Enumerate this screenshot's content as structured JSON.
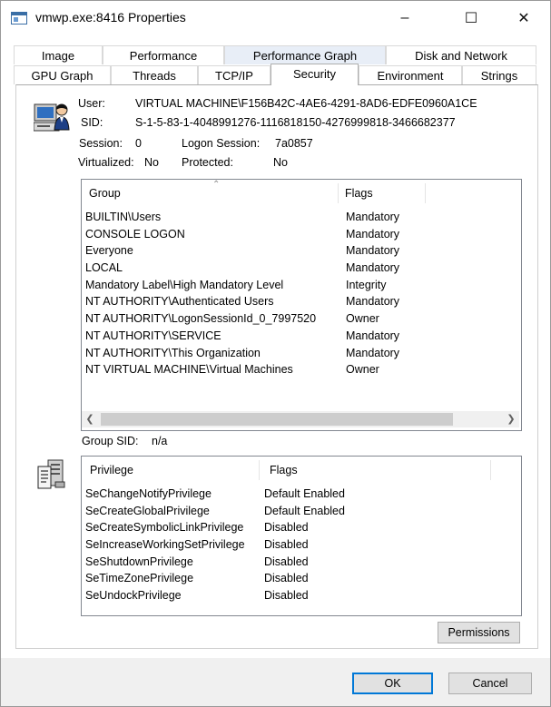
{
  "window": {
    "title": "vmwp.exe:8416 Properties",
    "controls": {
      "minimize": "–",
      "maximize": "☐",
      "close": "✕"
    }
  },
  "tabs": {
    "row1": [
      "Image",
      "Performance",
      "Performance Graph",
      "Disk and Network"
    ],
    "row2": [
      "GPU Graph",
      "Threads",
      "TCP/IP",
      "Security",
      "Environment",
      "Strings"
    ],
    "selected": "Security"
  },
  "security": {
    "user_label": "User:",
    "user_value": "VIRTUAL MACHINE\\F156B42C-4AE6-4291-8AD6-EDFE0960A1CE",
    "sid_label": "SID:",
    "sid_value": "S-1-5-83-1-4048991276-1116818150-4276999818-3466682377",
    "session_label": "Session:",
    "session_value": "0",
    "logon_label": "Logon Session:",
    "logon_value": "7a0857",
    "virtualized_label": "Virtualized:",
    "virtualized_value": "No",
    "protected_label": "Protected:",
    "protected_value": "No"
  },
  "groups": {
    "col_group": "Group",
    "col_flags": "Flags",
    "rows": [
      {
        "group": "BUILTIN\\Users",
        "flags": "Mandatory"
      },
      {
        "group": "CONSOLE LOGON",
        "flags": "Mandatory"
      },
      {
        "group": "Everyone",
        "flags": "Mandatory"
      },
      {
        "group": "LOCAL",
        "flags": "Mandatory"
      },
      {
        "group": "Mandatory Label\\High Mandatory Level",
        "flags": "Integrity"
      },
      {
        "group": "NT AUTHORITY\\Authenticated Users",
        "flags": "Mandatory"
      },
      {
        "group": "NT AUTHORITY\\LogonSessionId_0_7997520",
        "flags": "Owner"
      },
      {
        "group": "NT AUTHORITY\\SERVICE",
        "flags": "Mandatory"
      },
      {
        "group": "NT AUTHORITY\\This Organization",
        "flags": "Mandatory"
      },
      {
        "group": "NT VIRTUAL MACHINE\\Virtual Machines",
        "flags": "Owner"
      }
    ],
    "group_sid_label": "Group SID:",
    "group_sid_value": "n/a"
  },
  "privileges": {
    "col_privilege": "Privilege",
    "col_flags": "Flags",
    "rows": [
      {
        "privilege": "SeChangeNotifyPrivilege",
        "flags": "Default Enabled"
      },
      {
        "privilege": "SeCreateGlobalPrivilege",
        "flags": "Default Enabled"
      },
      {
        "privilege": "SeCreateSymbolicLinkPrivilege",
        "flags": "Disabled"
      },
      {
        "privilege": "SeIncreaseWorkingSetPrivilege",
        "flags": "Disabled"
      },
      {
        "privilege": "SeShutdownPrivilege",
        "flags": "Disabled"
      },
      {
        "privilege": "SeTimeZonePrivilege",
        "flags": "Disabled"
      },
      {
        "privilege": "SeUndockPrivilege",
        "flags": "Disabled"
      }
    ]
  },
  "buttons": {
    "permissions": "Permissions",
    "ok": "OK",
    "cancel": "Cancel"
  }
}
